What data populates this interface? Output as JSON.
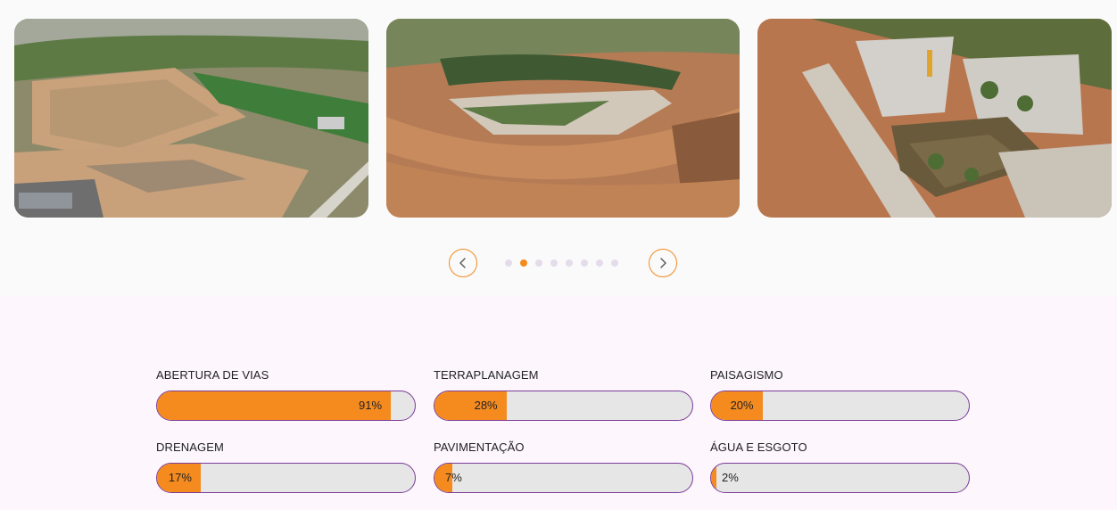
{
  "gallery": {
    "slides": [
      {
        "icon": "aerial-overview-photo"
      },
      {
        "icon": "dirt-road-curve-photo"
      },
      {
        "icon": "park-construction-photo"
      }
    ],
    "prev_icon": "chevron-left-icon",
    "next_icon": "chevron-right-icon",
    "dot_count": 8,
    "active_dot": 1,
    "accent_color": "#f28a1e"
  },
  "progress": {
    "fill_color": "#f58b1f",
    "track_color": "#e6e6e6",
    "border_color": "#7a3b98",
    "items": [
      {
        "label": "ABERTURA DE VIAS",
        "value": 91,
        "value_text": "91%"
      },
      {
        "label": "TERRAPLANAGEM",
        "value": 28,
        "value_text": "28%"
      },
      {
        "label": "PAISAGISMO",
        "value": 20,
        "value_text": "20%"
      },
      {
        "label": "DRENAGEM",
        "value": 17,
        "value_text": "17%"
      },
      {
        "label": "PAVIMENTAÇÃO",
        "value": 7,
        "value_text": "7%"
      },
      {
        "label": "ÁGUA E ESGOTO",
        "value": 2,
        "value_text": "2%"
      }
    ]
  }
}
